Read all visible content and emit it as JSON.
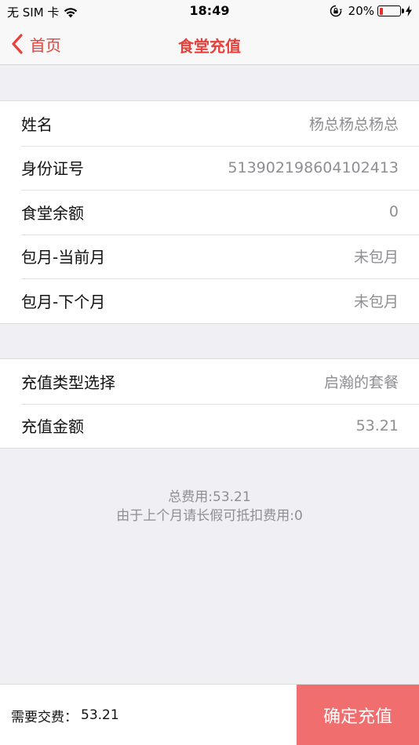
{
  "status_bar": {
    "carrier": "无 SIM 卡",
    "time": "18:49",
    "battery_percent": "20%",
    "battery_level": 0.2,
    "icons": [
      "wifi-icon",
      "rotation-lock-icon",
      "battery-icon",
      "charging-icon"
    ]
  },
  "nav": {
    "back_label": "首页",
    "title": "食堂充值",
    "accent_color": "#e8413b"
  },
  "info_rows": [
    {
      "label": "姓名",
      "value": "杨总杨总杨总"
    },
    {
      "label": "身份证号",
      "value": "513902198604102413"
    },
    {
      "label": "食堂余额",
      "value": "0"
    },
    {
      "label": "包月-当前月",
      "value": "未包月"
    },
    {
      "label": "包月-下个月",
      "value": "未包月"
    }
  ],
  "recharge_rows": [
    {
      "label": "充值类型选择",
      "value": "启瀚的套餐"
    },
    {
      "label": "充值金额",
      "value": "53.21"
    }
  ],
  "summary": {
    "total_line": "总费用:53.21",
    "deduction_line": "由于上个月请长假可抵扣费用:0"
  },
  "bottom_bar": {
    "pay_label": "需要交费：",
    "pay_amount": "53.21",
    "confirm_label": "确定充值",
    "button_color": "#f16e6f"
  }
}
